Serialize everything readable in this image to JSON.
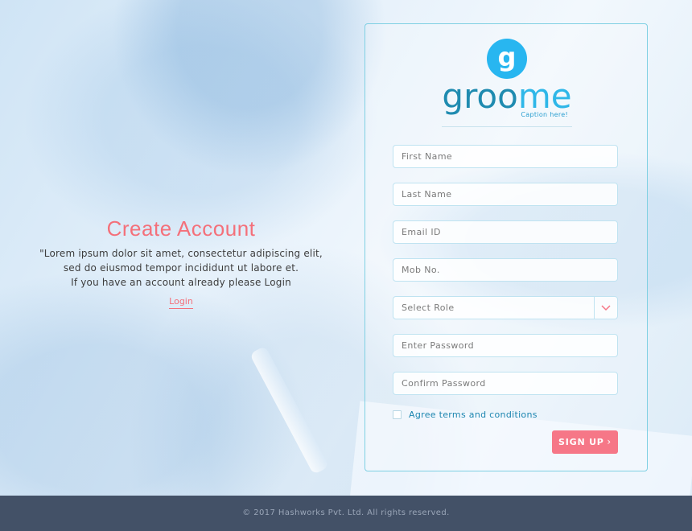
{
  "intro": {
    "title": "Create Account",
    "line1": "\"Lorem ipsum dolor sit amet, consectetur adipiscing elit,",
    "line2": "sed do eiusmod tempor incididunt ut labore et.",
    "line3": "If you have an account  already please Login",
    "login_link": "Login"
  },
  "logo": {
    "badge_letter": "g",
    "word_part1": "groo",
    "word_part2": "me",
    "caption": "Caption here!"
  },
  "form": {
    "first_name_placeholder": "First Name",
    "last_name_placeholder": "Last Name",
    "email_placeholder": "Email ID",
    "mobile_placeholder": "Mob No.",
    "role_select_label": "Select Role",
    "password_placeholder": "Enter Password",
    "confirm_password_placeholder": "Confirm Password",
    "agree_label": "Agree terms and conditions",
    "signup_label": "SIGN UP",
    "signup_chevron": "›"
  },
  "footer": {
    "copyright": "© 2017 Hashworks Pvt. Ltd. All rights reserved."
  },
  "colors": {
    "accent_pink": "#f67787",
    "brand_blue": "#28b6f0",
    "footer_bg": "#435167"
  },
  "icons": {
    "role_dropdown": "chevron-down-icon",
    "signup_arrow": "chevron-right-icon"
  }
}
